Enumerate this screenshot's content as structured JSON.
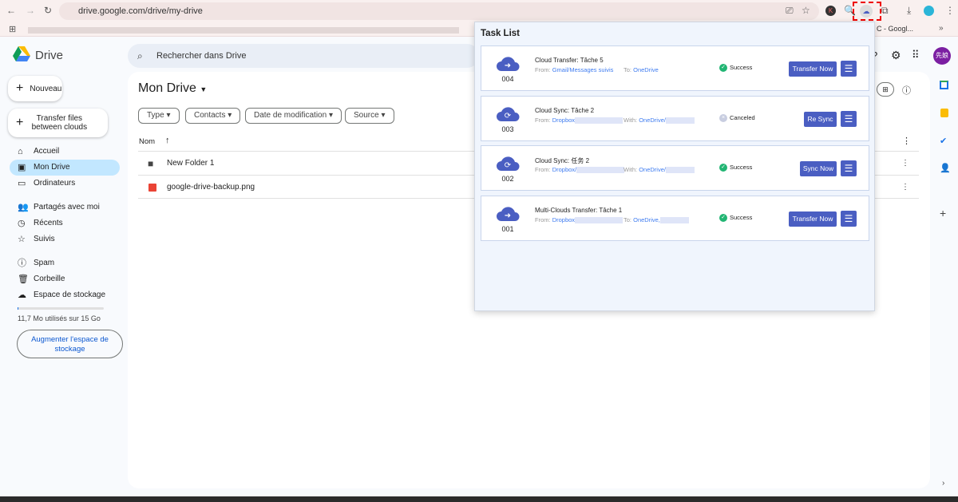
{
  "browser": {
    "url": "drive.google.com/drive/my-drive",
    "bookmark_fragment": "C - Googl...",
    "extension_letter": "K"
  },
  "drive": {
    "logo_text": "Drive",
    "search_placeholder": "Rechercher dans Drive",
    "avatar_text": "先娘",
    "new_button": "Nouveau",
    "transfer_button": "Transfer files between clouds",
    "nav": [
      {
        "label": "Accueil",
        "icon": "home-icon"
      },
      {
        "label": "Mon Drive",
        "icon": "drive-icon",
        "active": true
      },
      {
        "label": "Ordinateurs",
        "icon": "computer-icon"
      },
      {
        "label": "Partagés avec moi",
        "icon": "shared-icon"
      },
      {
        "label": "Récents",
        "icon": "clock-icon"
      },
      {
        "label": "Suivis",
        "icon": "star-icon"
      },
      {
        "label": "Spam",
        "icon": "spam-icon"
      },
      {
        "label": "Corbeille",
        "icon": "trash-icon"
      },
      {
        "label": "Espace de stockage",
        "icon": "cloud-icon"
      }
    ],
    "storage_text": "11,7 Mo utilisés sur 15 Go",
    "storage_fraction": 0.0008,
    "upgrade_button": "Augmenter l'espace de stockage",
    "page_title": "Mon Drive",
    "filters": [
      "Type",
      "Contacts",
      "Date de modification",
      "Source"
    ],
    "column_name": "Nom",
    "files": [
      {
        "name": "New Folder 1",
        "type": "folder"
      },
      {
        "name": "google-drive-backup.png",
        "type": "image"
      }
    ]
  },
  "popup": {
    "title": "Task List",
    "tasks": [
      {
        "id": "004",
        "title": "Cloud Transfer: Tâche 5",
        "from_label": "From:",
        "from": "Gmail/Messages suivis",
        "to_label": "To:",
        "to": "OneDrive",
        "status": "Success",
        "action": "Transfer Now",
        "kind": "transfer"
      },
      {
        "id": "003",
        "title": "Cloud Sync: Tâche 2",
        "from_label": "From:",
        "from": "Dropbox",
        "to_label": "With:",
        "to": "OneDrive/",
        "status": "Canceled",
        "action": "Re Sync",
        "kind": "sync"
      },
      {
        "id": "002",
        "title": "Cloud Sync: 任务 2",
        "from_label": "From:",
        "from": "Dropbox/",
        "to_label": "With:",
        "to": "OneDrive/",
        "status": "Success",
        "action": "Sync Now",
        "kind": "sync"
      },
      {
        "id": "001",
        "title": "Multi-Clouds Transfer: Tâche 1",
        "from_label": "From:",
        "from": "Dropbox",
        "to_label": "To:",
        "to": "OneDrive,",
        "status": "Success",
        "action": "Transfer Now",
        "kind": "transfer"
      }
    ]
  },
  "colors": {
    "accent": "#4a5ec2",
    "success": "#21b573",
    "link": "#3f7cf0",
    "active_nav": "#c2e7ff"
  }
}
